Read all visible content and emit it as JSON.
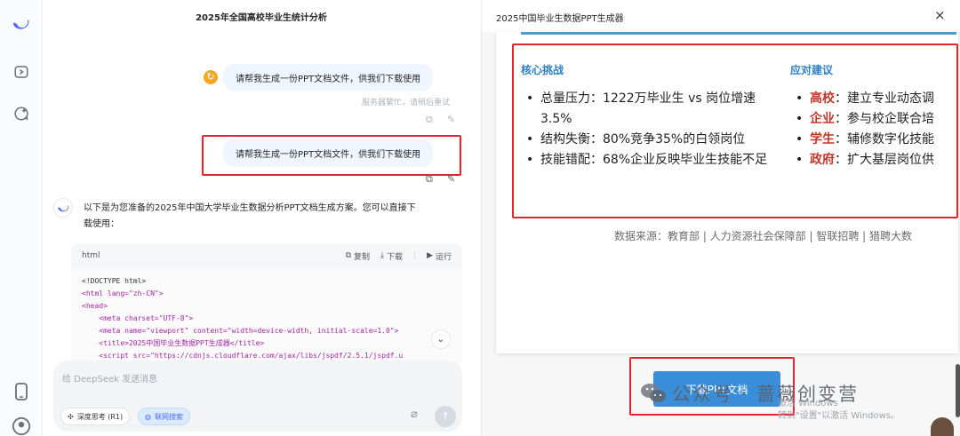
{
  "chat": {
    "title": "2025年全国高校毕业生统计分析",
    "msg1": "请帮我生成一份PPT文档文件，供我们下载使用",
    "msg1_status": "服务器繁忙，请稍后重试",
    "msg2": "请帮我生成一份PPT文档文件，供我们下载使用",
    "ai_reply_line1": "以下是为您准备的2025年中国大学毕业生数据分析PPT文档生成方案。您可以直接下",
    "ai_reply_line2": "载使用：",
    "code": {
      "lang": "html",
      "copy": "复制",
      "download": "下载",
      "run": "运行",
      "lines": [
        "<!DOCTYPE html>",
        "<html lang=\"zh-CN\">",
        "<head>",
        "    <meta charset=\"UTF-8\">",
        "    <meta name=\"viewport\" content=\"width=device-width, initial-scale=1.0\">",
        "    <title>2025中国毕业生数据PPT生成器</title>",
        "    <script src=\"https://cdnjs.cloudflare.com/ajax/libs/jspdf/2.5.1/jspdf.u"
      ]
    },
    "input_placeholder": "给 DeepSeek 发送消息",
    "deep_think": "深度思考 (R1)",
    "web_search": "联网搜索"
  },
  "preview": {
    "title": "2025中国毕业生数据PPT生成器",
    "close": "×",
    "col1_heading": "核心挑战",
    "col1_items": [
      {
        "label": "总量压力：",
        "text": "1222万毕业生 vs 岗位增速3.5%"
      },
      {
        "label": "结构失衡：",
        "text": "80%竞争35%的白领岗位"
      },
      {
        "label": "技能错配：",
        "text": "68%企业反映毕业生技能不足"
      }
    ],
    "col2_heading": "应对建议",
    "col2_items": [
      {
        "label": "高校",
        "text": "：建立专业动态调"
      },
      {
        "label": "企业",
        "text": "：参与校企联合培"
      },
      {
        "label": "学生",
        "text": "：辅修数字化技能"
      },
      {
        "label": "政府",
        "text": "：扩大基层岗位供"
      }
    ],
    "source": "数据来源：教育部 | 人力资源社会保障部 | 智联招聘 | 猎聘大数",
    "download_button": "下载PPT文档",
    "watermark_text": "公众号 · 蔷薇创变营",
    "activate_line1": "激活 Windows",
    "activate_line2": "转到\"设置\"以激活 Windows。"
  },
  "colors": {
    "accent_blue": "#4d6bfe",
    "highlight_red": "#e5242b",
    "heading_blue": "#2f7fc1",
    "button_blue": "#3a8dd8"
  }
}
